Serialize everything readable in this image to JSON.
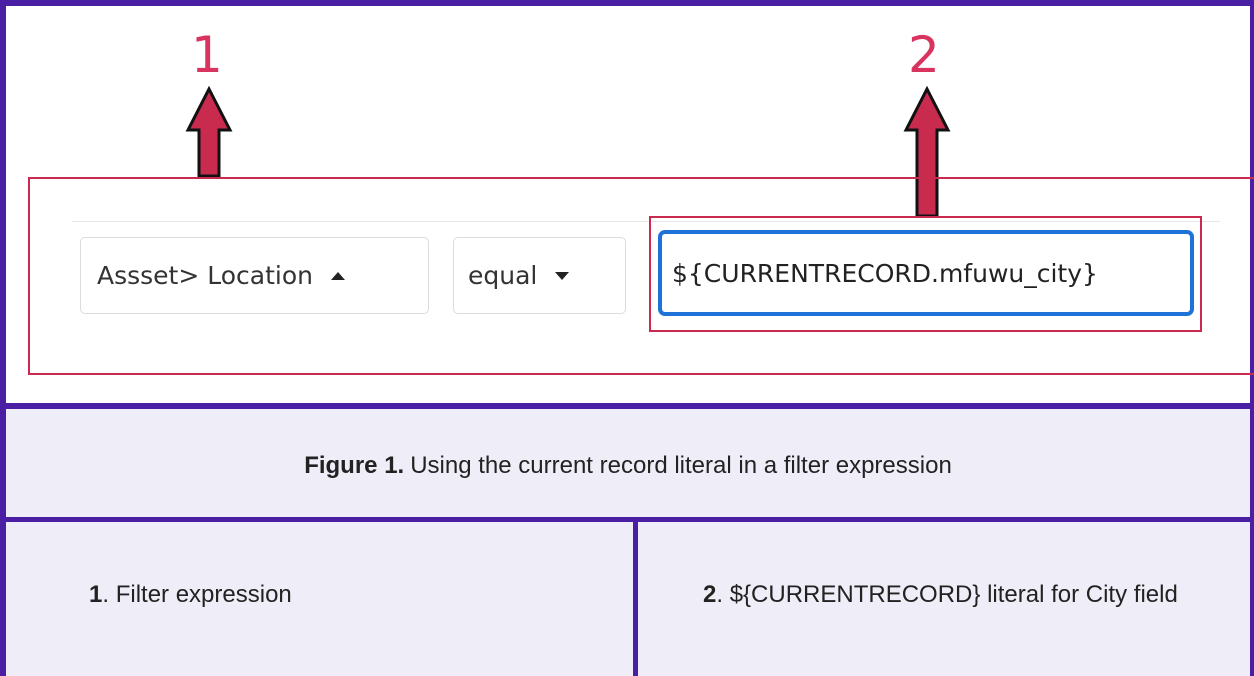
{
  "callouts": {
    "one": "1",
    "two": "2"
  },
  "filter": {
    "field_label": "Assset> Location",
    "operator_label": "equal",
    "value": "${CURRENTRECORD.mfuwu_city}"
  },
  "caption": {
    "bold": "Figure 1.",
    "text": "Using the current record literal in a filter expression"
  },
  "descriptions": {
    "left_num": "1",
    "left_text": ". Filter expression",
    "right_num": "2",
    "right_text": ". ${CURRENTRECORD} literal for City field"
  },
  "colors": {
    "frame": "#4b1fa3",
    "callout": "#d8345f",
    "highlight_border": "#c92b4f",
    "focus": "#1f73d8",
    "arrow_fill": "#c92b4f"
  }
}
